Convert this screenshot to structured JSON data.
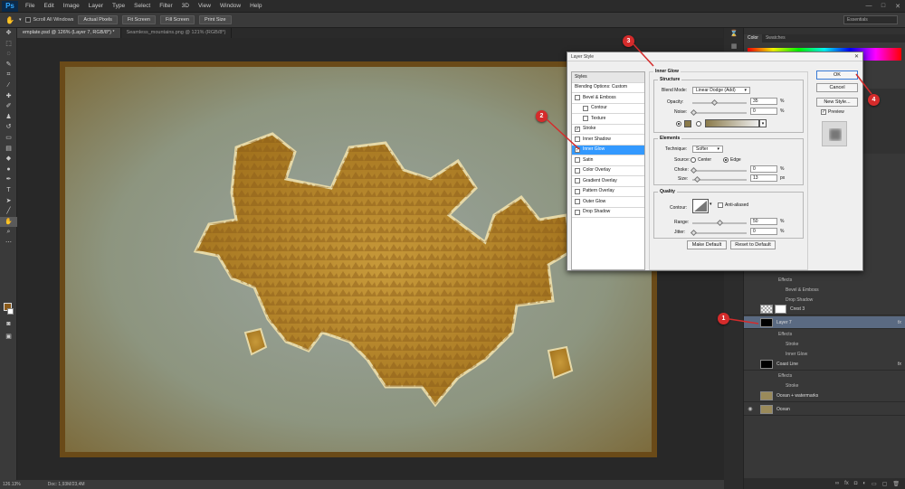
{
  "app": {
    "logo": "Ps"
  },
  "menu": [
    "File",
    "Edit",
    "Image",
    "Layer",
    "Type",
    "Select",
    "Filter",
    "3D",
    "View",
    "Window",
    "Help"
  ],
  "window_controls": [
    "—",
    "□",
    "✕"
  ],
  "options": {
    "scroll_all": "Scroll All Windows",
    "buttons": [
      "Actual Pixels",
      "Fit Screen",
      "Fill Screen",
      "Print Size"
    ],
    "workspace": "Essentials"
  },
  "doc_tabs": [
    "emplate.psd @ 126% (Layer 7, RGB/8*) *",
    "Seamless_mountains.png @ 121% (RGB/8*)"
  ],
  "status": {
    "zoom": "126.13%",
    "doc": "Doc: 1,93M/23,4M"
  },
  "panels": {
    "color_tabs": [
      "Color",
      "Swatches"
    ]
  },
  "layers": [
    {
      "kind": "effects",
      "label": "Effects"
    },
    {
      "kind": "sub",
      "label": "Bevel & Emboss"
    },
    {
      "kind": "sub",
      "label": "Drop Shadow"
    },
    {
      "kind": "layer",
      "label": "Crest 3"
    },
    {
      "kind": "layer",
      "label": "Layer 7"
    },
    {
      "kind": "effects",
      "label": "Effects"
    },
    {
      "kind": "sub",
      "label": "Stroke"
    },
    {
      "kind": "sub",
      "label": "Inner Glow"
    },
    {
      "kind": "layer",
      "label": "Coast Line"
    },
    {
      "kind": "effects",
      "label": "Effects"
    },
    {
      "kind": "sub",
      "label": "Stroke"
    },
    {
      "kind": "layer",
      "label": "Ocean + watermarks"
    },
    {
      "kind": "layer",
      "label": "Ocean"
    }
  ],
  "dialog": {
    "title": "Layer Style",
    "styles_header": "Styles",
    "blending": "Blending Options: Custom",
    "styles": [
      {
        "label": "Bevel & Emboss",
        "checked": false
      },
      {
        "label": "Contour",
        "checked": false
      },
      {
        "label": "Texture",
        "checked": false
      },
      {
        "label": "Stroke",
        "checked": true
      },
      {
        "label": "Inner Shadow",
        "checked": false
      },
      {
        "label": "Inner Glow",
        "checked": true
      },
      {
        "label": "Satin",
        "checked": false
      },
      {
        "label": "Color Overlay",
        "checked": false
      },
      {
        "label": "Gradient Overlay",
        "checked": false
      },
      {
        "label": "Pattern Overlay",
        "checked": false
      },
      {
        "label": "Outer Glow",
        "checked": false
      },
      {
        "label": "Drop Shadow",
        "checked": false
      }
    ],
    "section": "Inner Glow",
    "structure": {
      "legend": "Structure",
      "blend_label": "Blend Mode:",
      "blend_value": "Linear Dodge (Add)",
      "opacity_label": "Opacity:",
      "opacity": "35",
      "noise_label": "Noise:",
      "noise": "0",
      "pct": "%"
    },
    "elements": {
      "legend": "Elements",
      "technique_label": "Technique:",
      "technique": "Softer",
      "source_label": "Source:",
      "center": "Center",
      "edge": "Edge",
      "choke_label": "Choke:",
      "choke": "0",
      "size_label": "Size:",
      "size": "13",
      "px": "px"
    },
    "quality": {
      "legend": "Quality",
      "contour_label": "Contour:",
      "anti_aliased": "Anti-aliased",
      "range_label": "Range:",
      "range": "50",
      "jitter_label": "Jitter:",
      "jitter": "0"
    },
    "make_default": "Make Default",
    "reset_default": "Reset to Default",
    "ok": "OK",
    "cancel": "Cancel",
    "new_style": "New Style...",
    "preview": "Preview"
  },
  "callouts": [
    "1",
    "2",
    "3",
    "4"
  ],
  "colors": {
    "selection": "#3399ff",
    "callout": "#d52b2b",
    "map_land": "#b8862a",
    "map_sea": "#8a9a9a"
  }
}
